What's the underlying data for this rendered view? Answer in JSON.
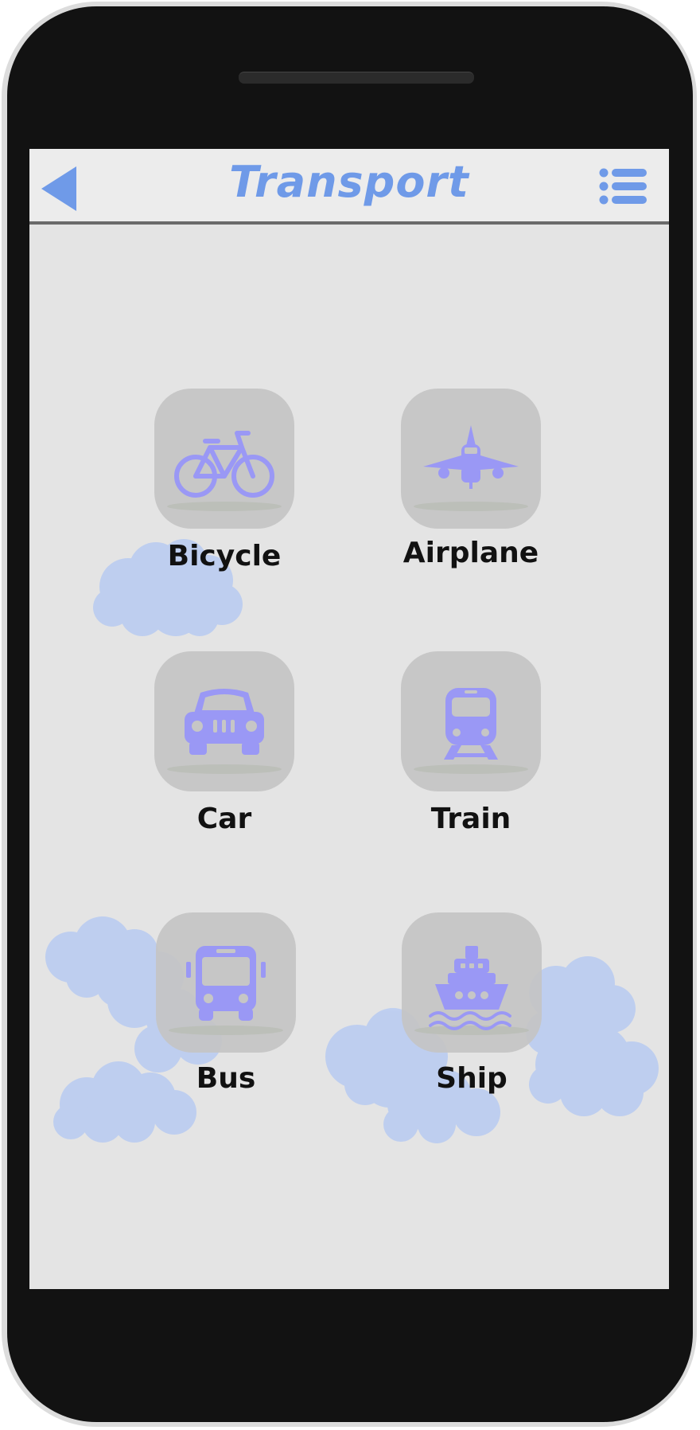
{
  "header": {
    "title": "Transport",
    "back_icon": "back-arrow-icon",
    "menu_icon": "list-menu-icon",
    "accent_color": "#6f9ae8"
  },
  "tiles": [
    {
      "label": "Bicycle",
      "icon": "bicycle-icon"
    },
    {
      "label": "Airplane",
      "icon": "airplane-icon"
    },
    {
      "label": "Car",
      "icon": "car-icon"
    },
    {
      "label": "Train",
      "icon": "train-icon"
    },
    {
      "label": "Bus",
      "icon": "bus-icon"
    },
    {
      "label": "Ship",
      "icon": "ship-icon"
    }
  ],
  "colors": {
    "icon": "#9a98f5",
    "cloud": "#bccdf0",
    "tile": "#c6c6c6",
    "screen": "#e4e4e4"
  }
}
